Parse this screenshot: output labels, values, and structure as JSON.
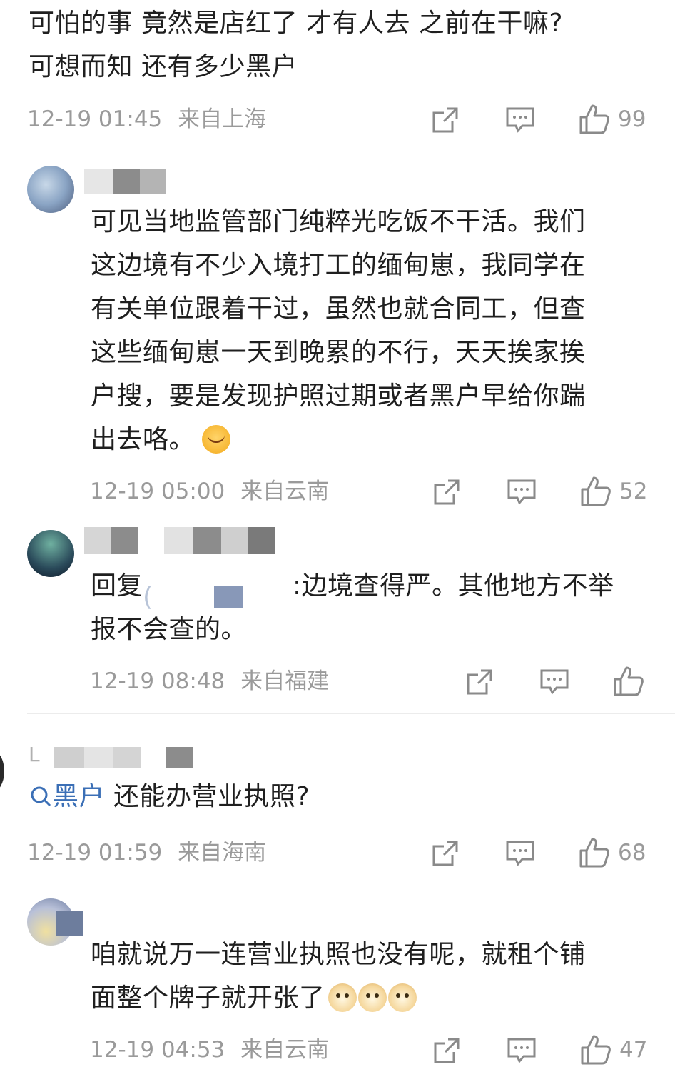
{
  "comments": [
    {
      "text_line1": "可怕的事 竟然是店红了 才有人去 之前在干嘛?",
      "text_line2": "可想而知 还有多少黑户",
      "time": "12-19 01:45",
      "location": "来自上海",
      "likes": "99"
    },
    {
      "lines": [
        "可见当地监管部门纯粹光吃饭不干活。我们",
        "这边境有不少入境打工的缅甸崽，我同学在",
        "有关单位跟着干过，虽然也就合同工，但查",
        "这些缅甸崽一天到晚累的不行，天天挨家挨",
        "户搜，要是发现护照过期或者黑户早给你踹",
        "出去咯。"
      ],
      "time": "12-19 05:00",
      "location": "来自云南",
      "likes": "52"
    },
    {
      "reply_prefix": "回复",
      "reply_rest": ":边境查得严。其他地方不举",
      "line2": "报不会查的。",
      "time": "12-19 08:48",
      "location": "来自福建",
      "likes": ""
    },
    {
      "username_visible": "L",
      "search_keyword": "黑户",
      "text": " 还能办营业执照?",
      "time": "12-19 01:59",
      "location": "来自海南",
      "likes": "68"
    },
    {
      "line1": "咱就说万一连营业执照也没有呢，就租个铺",
      "line2": "面整个牌子就开张了",
      "time": "12-19 04:53",
      "location": "来自云南",
      "likes": "47"
    }
  ],
  "icons": {
    "share": "share-icon",
    "comment": "comment-icon",
    "like": "thumbs-up-icon",
    "search": "search-icon"
  },
  "colors": {
    "meta": "#9a9a9a",
    "text": "#1f1f1f",
    "link": "#3b6fb6"
  }
}
